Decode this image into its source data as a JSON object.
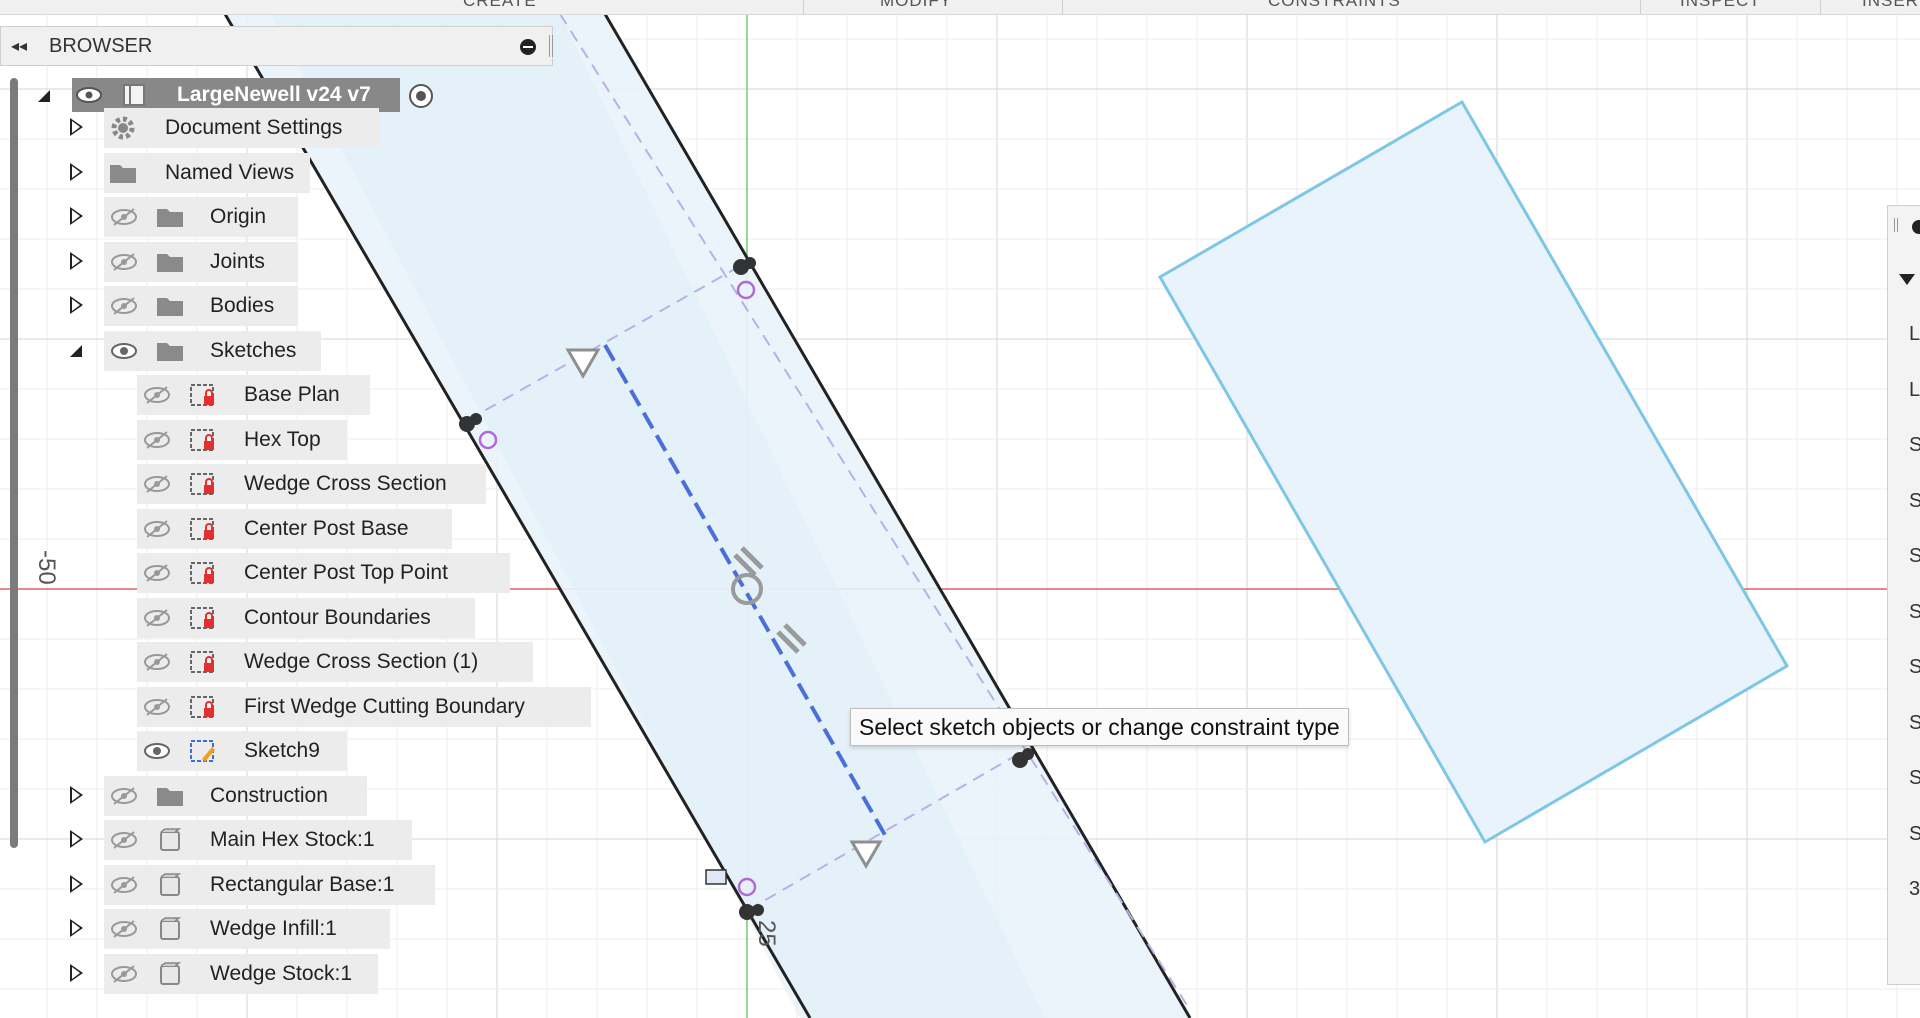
{
  "toolbar": {
    "tabs": [
      "CREATE",
      "MODIFY",
      "CONSTRAINTS",
      "INSPECT",
      "INSERT"
    ]
  },
  "browser": {
    "title": "BROWSER",
    "collapse_glyph": "◂◂",
    "root": {
      "label": "LargeNewell v24 v7"
    },
    "items": [
      {
        "label": "Document Settings",
        "icon": "gear-icon"
      },
      {
        "label": "Named Views",
        "icon": "folder-icon"
      },
      {
        "label": "Origin",
        "icon": "folder-icon"
      },
      {
        "label": "Joints",
        "icon": "folder-icon"
      },
      {
        "label": "Bodies",
        "icon": "folder-icon"
      },
      {
        "label": "Sketches",
        "icon": "folder-icon"
      },
      {
        "label": "Construction",
        "icon": "folder-icon"
      },
      {
        "label": "Main Hex Stock:1",
        "icon": "component-icon"
      },
      {
        "label": "Rectangular Base:1",
        "icon": "component-icon"
      },
      {
        "label": "Wedge Infill:1",
        "icon": "component-icon"
      },
      {
        "label": "Wedge Stock:1",
        "icon": "component-icon"
      }
    ],
    "sketches": [
      {
        "label": "Base Plan"
      },
      {
        "label": "Hex Top"
      },
      {
        "label": "Wedge Cross Section"
      },
      {
        "label": "Center Post Base"
      },
      {
        "label": "Center Post Top Point"
      },
      {
        "label": "Contour Boundaries"
      },
      {
        "label": "Wedge Cross Section (1)"
      },
      {
        "label": "First Wedge Cutting Boundary"
      },
      {
        "label": "Sketch9"
      }
    ]
  },
  "canvas": {
    "tooltip": "Select sketch objects or change constraint type",
    "axis_label_left": "-50",
    "axis_label_bottom": "25",
    "colors": {
      "grid": "#e4e4e4",
      "x_axis": "#e06060",
      "y_axis": "#6fcf6f",
      "fill": "#e9f3fb",
      "outline_blue": "#7fc6e6",
      "dashed": "#4a6fd8",
      "construction": "#b7b1e6"
    }
  },
  "right_panel": {
    "letters": [
      "L",
      "L",
      "S",
      "S",
      "S",
      "S",
      "S",
      "S",
      "S",
      "S",
      "3"
    ]
  }
}
